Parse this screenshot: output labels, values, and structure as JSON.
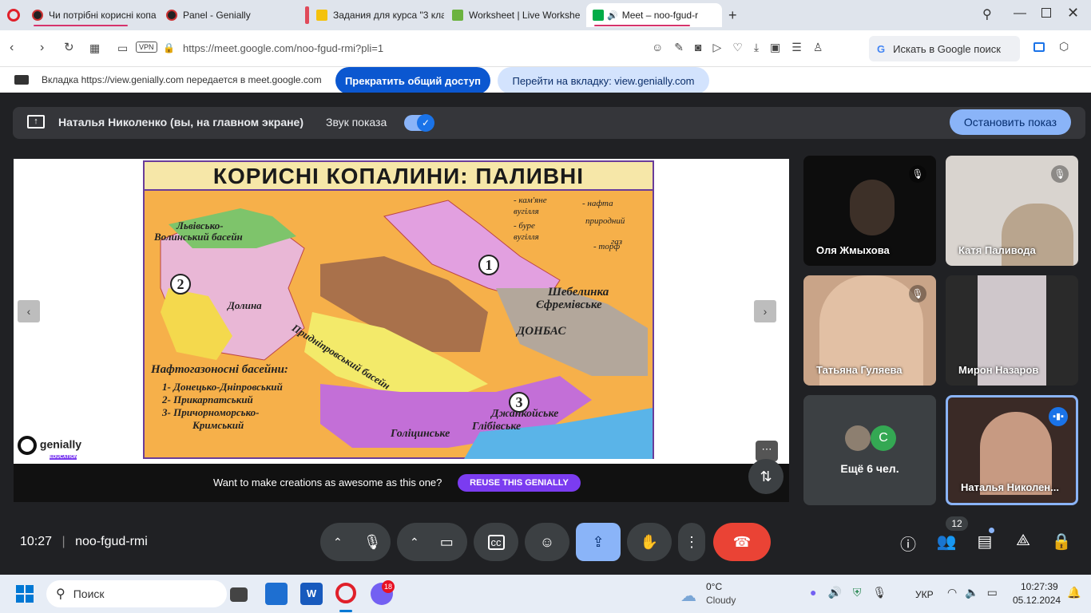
{
  "tabs": [
    {
      "title": "Чи потрібні корисні копа",
      "icon": "genially-icon"
    },
    {
      "title": "Panel - Genially",
      "icon": "genially-icon"
    },
    {
      "title": "Задания для курса \"3 кла",
      "icon": "classroom-icon"
    },
    {
      "title": "Worksheet | Live Workshe",
      "icon": "liveworksheets-icon"
    },
    {
      "title": "Meet – noo-fgud-r",
      "icon": "meet-icon"
    }
  ],
  "address": {
    "url": "https://meet.google.com/noo-fgud-rmi?pli=1",
    "vpn": "VPN",
    "search_placeholder": "Искать в Google поиск"
  },
  "share_bar": {
    "info": "Вкладка https://view.genially.com передается в meet.google.com",
    "stop_share": "Прекратить общий доступ",
    "switch_tab": "Перейти на вкладку: view.genially.com"
  },
  "presenting": {
    "name": "Наталья Николенко (вы, на главном экране)",
    "sound": "Звук показа",
    "stop": "Остановить показ"
  },
  "slide": {
    "title": "КОРИСНІ КОПАЛИНИ: ПАЛИВНІ",
    "legend": [
      "- кам'яне",
      "вугілля",
      "- нафта",
      "- буре",
      "вугілля",
      "природний",
      "газ",
      "- торф"
    ],
    "regions": [
      "Львівсько-",
      "Волинський басейн",
      "Долина",
      "Придніпровський басейн",
      "Шебелинка",
      "Єфремівське",
      "ДОНБАС",
      "Джанкойське",
      "Глібівське",
      "Голіцинське"
    ],
    "numbers": [
      "1",
      "2",
      "3"
    ],
    "basins_title": "Нафтогазоносні басейни:",
    "basins": [
      "1- Донецько-Дніпровський",
      "2- Прикарпатський",
      "3- Причорноморсько-",
      "Кримський"
    ]
  },
  "genially": {
    "logo": "genially",
    "sub": "EDUCATION",
    "promo": "Want to make creations as awesome as this one?",
    "reuse": "REUSE THIS GENIALLY"
  },
  "participants": [
    {
      "name": "Оля Жмыхова",
      "muted": true
    },
    {
      "name": "Катя Паливода",
      "muted": true
    },
    {
      "name": "Татьяна Гуляева",
      "muted": true
    },
    {
      "name": "Мирон Назаров",
      "muted": false
    },
    {
      "name": "Ещё 6 чел.",
      "avatar_letter": "С"
    },
    {
      "name": "Наталья Николен...",
      "speaking": true
    }
  ],
  "meeting": {
    "time": "10:27",
    "code": "noo-fgud-rmi",
    "people_count": "12"
  },
  "taskbar": {
    "search": "Поиск",
    "weather_temp": "0°C",
    "weather_desc": "Cloudy",
    "lang": "УКР",
    "time": "10:27:39",
    "date": "05.12.2024",
    "badge": "18"
  }
}
